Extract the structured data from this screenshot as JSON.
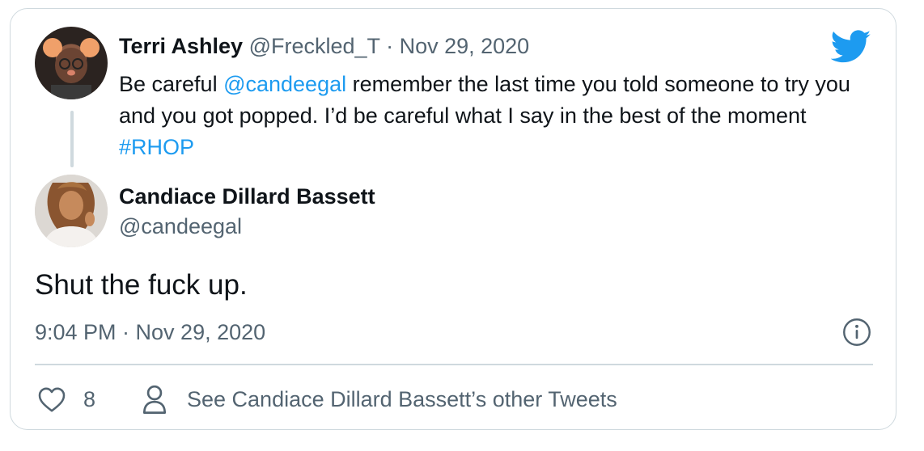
{
  "quoted_tweet": {
    "author_name": "Terri Ashley",
    "author_handle": "@Freckled_T",
    "separator": "·",
    "date": "Nov 29, 2020",
    "text_before_mention": "Be careful ",
    "mention": "@candeegal",
    "text_after_mention": " remember the last time you told someone to try you and you got popped. I’d be careful what I say in the best of the moment ",
    "hashtag": "#RHOP"
  },
  "main_tweet": {
    "author_name": "Candiace Dillard Bassett",
    "author_handle": "@candeegal",
    "text": "Shut the fuck up.",
    "timestamp": "9:04 PM · Nov 29, 2020"
  },
  "actions": {
    "like_count": "8",
    "other_tweets_label": "See Candiace Dillard Bassett’s other Tweets"
  },
  "icons": {
    "brand": "twitter-bird-icon",
    "info": "info-icon",
    "like": "heart-icon",
    "profile": "person-icon"
  },
  "colors": {
    "brand_blue": "#1d9bf0",
    "muted_text": "#536471",
    "border": "#cfd9de"
  }
}
